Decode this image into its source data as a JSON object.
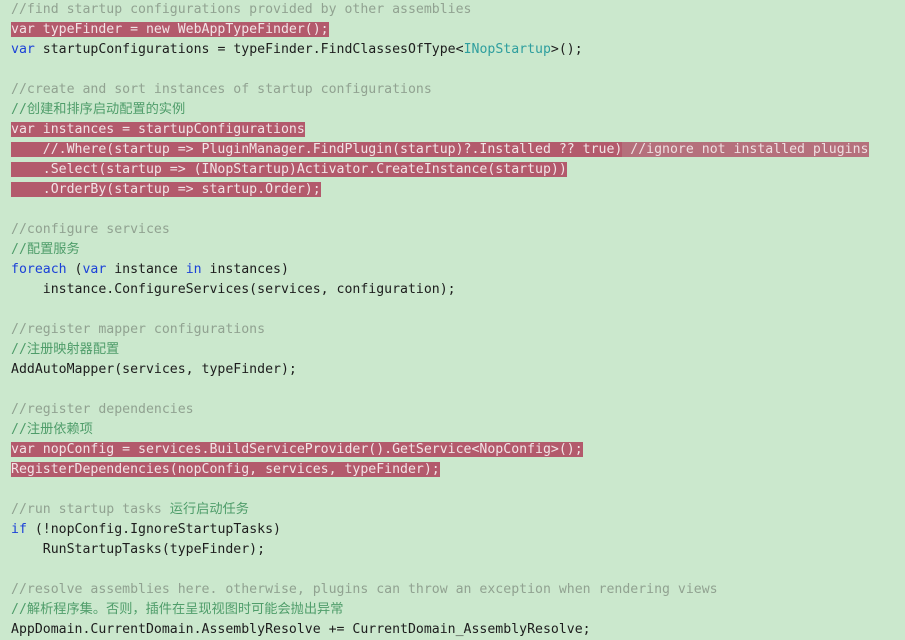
{
  "window": {
    "app": "code-editor",
    "language": "C#",
    "background_color": "#cbe8cd",
    "selection_background_color": "#b35a6c",
    "selection_text_color": "#f2e4e6",
    "comment_color": "#91a291",
    "chinese_comment_color": "#4f9d6a",
    "keyword_color": "#1b41d8",
    "type_color": "#2e9e9e",
    "text_color": "#1d1d1d"
  },
  "lines": [
    {
      "id": "line-1",
      "selected": false,
      "tokens": [
        {
          "t": "//find startup configurations provided by other assemblies",
          "c": "cmt"
        }
      ]
    },
    {
      "id": "line-2",
      "selected": true,
      "tokens": [
        {
          "t": "var typeFinder = new WebAppTypeFinder();",
          "c": "plain",
          "sel": true
        }
      ]
    },
    {
      "id": "line-3",
      "selected": false,
      "tokens": [
        {
          "t": "var",
          "c": "kw"
        },
        {
          "t": " startupConfigurations = typeFinder.FindClassesOfType<",
          "c": "plain"
        },
        {
          "t": "INopStartup",
          "c": "type"
        },
        {
          "t": ">();",
          "c": "plain"
        }
      ]
    },
    {
      "id": "line-4",
      "selected": false,
      "tokens": []
    },
    {
      "id": "line-5",
      "selected": false,
      "tokens": [
        {
          "t": "//create and sort instances of startup configurations",
          "c": "cmt"
        }
      ]
    },
    {
      "id": "line-6",
      "selected": false,
      "tokens": [
        {
          "t": "//创建和排序启动配置的实例",
          "c": "cmt-cn"
        }
      ]
    },
    {
      "id": "line-7",
      "selected": true,
      "tokens": [
        {
          "t": "var instances = startupConfigurations",
          "c": "plain",
          "sel": true
        }
      ]
    },
    {
      "id": "line-8",
      "selected": true,
      "tokens": [
        {
          "t": "    //.Where(startup => PluginManager.FindPlugin(startup)?.Installed ?? true)",
          "c": "plain",
          "sel": true
        },
        {
          "t": " //ignore not installed plugins",
          "c": "plain",
          "selcmt": true
        }
      ]
    },
    {
      "id": "line-9",
      "selected": true,
      "tokens": [
        {
          "t": "    .Select(startup => (INopStartup)Activator.CreateInstance(startup))",
          "c": "plain",
          "sel": true
        }
      ]
    },
    {
      "id": "line-10",
      "selected": true,
      "tokens": [
        {
          "t": "    .OrderBy(startup => startup.Order);",
          "c": "plain",
          "sel": true
        }
      ]
    },
    {
      "id": "line-11",
      "selected": false,
      "tokens": []
    },
    {
      "id": "line-12",
      "selected": false,
      "tokens": [
        {
          "t": "//configure services",
          "c": "cmt"
        }
      ]
    },
    {
      "id": "line-13",
      "selected": false,
      "tokens": [
        {
          "t": "//配置服务",
          "c": "cmt-cn"
        }
      ]
    },
    {
      "id": "line-14",
      "selected": false,
      "tokens": [
        {
          "t": "foreach",
          "c": "kw"
        },
        {
          "t": " (",
          "c": "plain"
        },
        {
          "t": "var",
          "c": "kw"
        },
        {
          "t": " instance ",
          "c": "plain"
        },
        {
          "t": "in",
          "c": "kw"
        },
        {
          "t": " instances)",
          "c": "plain"
        }
      ]
    },
    {
      "id": "line-15",
      "selected": false,
      "tokens": [
        {
          "t": "    instance.ConfigureServices(services, configuration);",
          "c": "plain"
        }
      ]
    },
    {
      "id": "line-16",
      "selected": false,
      "tokens": []
    },
    {
      "id": "line-17",
      "selected": false,
      "tokens": [
        {
          "t": "//register mapper configurations",
          "c": "cmt"
        }
      ]
    },
    {
      "id": "line-18",
      "selected": false,
      "tokens": [
        {
          "t": "//注册映射器配置",
          "c": "cmt-cn"
        }
      ]
    },
    {
      "id": "line-19",
      "selected": false,
      "tokens": [
        {
          "t": "AddAutoMapper(services, typeFinder);",
          "c": "plain"
        }
      ]
    },
    {
      "id": "line-20",
      "selected": false,
      "tokens": []
    },
    {
      "id": "line-21",
      "selected": false,
      "tokens": [
        {
          "t": "//register dependencies",
          "c": "cmt"
        }
      ]
    },
    {
      "id": "line-22",
      "selected": false,
      "tokens": [
        {
          "t": "//注册依赖项",
          "c": "cmt-cn"
        }
      ]
    },
    {
      "id": "line-23",
      "selected": true,
      "tokens": [
        {
          "t": "var nopConfig = services.BuildServiceProvider().GetService<NopConfig>();",
          "c": "plain",
          "sel": true
        }
      ]
    },
    {
      "id": "line-24",
      "selected": true,
      "tokens": [
        {
          "t": "RegisterDependencies(nopConfig, services, typeFinder);",
          "c": "plain",
          "sel": true
        }
      ]
    },
    {
      "id": "line-25",
      "selected": false,
      "tokens": []
    },
    {
      "id": "line-26",
      "selected": false,
      "tokens": [
        {
          "t": "//run startup tasks ",
          "c": "cmt"
        },
        {
          "t": "运行启动任务",
          "c": "cmt-cn"
        }
      ]
    },
    {
      "id": "line-27",
      "selected": false,
      "tokens": [
        {
          "t": "if",
          "c": "kw"
        },
        {
          "t": " (!nopConfig.IgnoreStartupTasks)",
          "c": "plain"
        }
      ]
    },
    {
      "id": "line-28",
      "selected": false,
      "tokens": [
        {
          "t": "    RunStartupTasks(typeFinder);",
          "c": "plain"
        }
      ]
    },
    {
      "id": "line-29",
      "selected": false,
      "tokens": []
    },
    {
      "id": "line-30",
      "selected": false,
      "tokens": [
        {
          "t": "//resolve assemblies here. otherwise, plugins can throw an exception when rendering views",
          "c": "cmt"
        }
      ]
    },
    {
      "id": "line-31",
      "selected": false,
      "tokens": [
        {
          "t": "//解析程序集。否则，插件在呈现视图时可能会抛出异常",
          "c": "cmt-cn"
        }
      ]
    },
    {
      "id": "line-32",
      "selected": false,
      "tokens": [
        {
          "t": "AppDomain.CurrentDomain.AssemblyResolve += CurrentDomain_AssemblyResolve;",
          "c": "plain"
        }
      ]
    }
  ]
}
